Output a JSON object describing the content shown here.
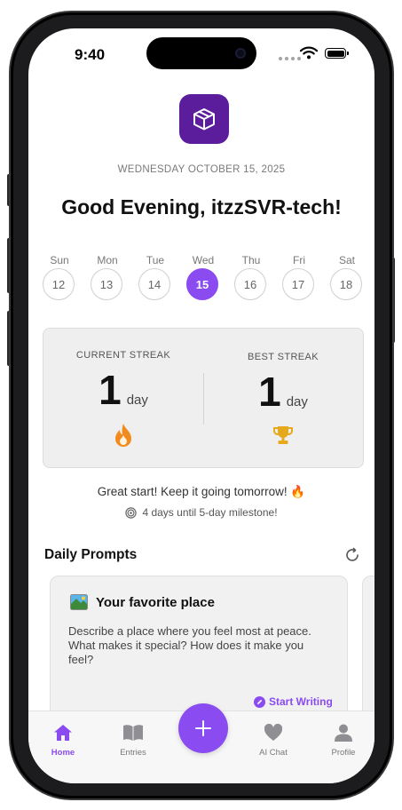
{
  "status": {
    "time": "9:40"
  },
  "header": {
    "date": "WEDNESDAY OCTOBER 15, 2025",
    "greeting": "Good Evening, itzzSVR-tech!"
  },
  "week": [
    {
      "name": "Sun",
      "num": "12",
      "active": false
    },
    {
      "name": "Mon",
      "num": "13",
      "active": false
    },
    {
      "name": "Tue",
      "num": "14",
      "active": false
    },
    {
      "name": "Wed",
      "num": "15",
      "active": true
    },
    {
      "name": "Thu",
      "num": "16",
      "active": false
    },
    {
      "name": "Fri",
      "num": "17",
      "active": false
    },
    {
      "name": "Sat",
      "num": "18",
      "active": false
    }
  ],
  "streak": {
    "current_label": "CURRENT STREAK",
    "current_value": "1",
    "current_unit": "day",
    "best_label": "BEST STREAK",
    "best_value": "1",
    "best_unit": "day"
  },
  "encouragement": "Great start! Keep it going tomorrow! 🔥",
  "milestone": "4 days until 5-day milestone!",
  "prompts": {
    "title": "Daily Prompts",
    "card": {
      "title": "Your favorite place",
      "body": "Describe a place where you feel most at peace. What makes it special? How does it make you feel?",
      "action": "Start Writing"
    }
  },
  "tabs": {
    "home": "Home",
    "entries": "Entries",
    "ai_chat": "AI Chat",
    "profile": "Profile"
  },
  "colors": {
    "accent": "#8a4bf0",
    "app_icon": "#5b1d9c",
    "flame": "#f28b1e",
    "trophy": "#e7a91c"
  }
}
